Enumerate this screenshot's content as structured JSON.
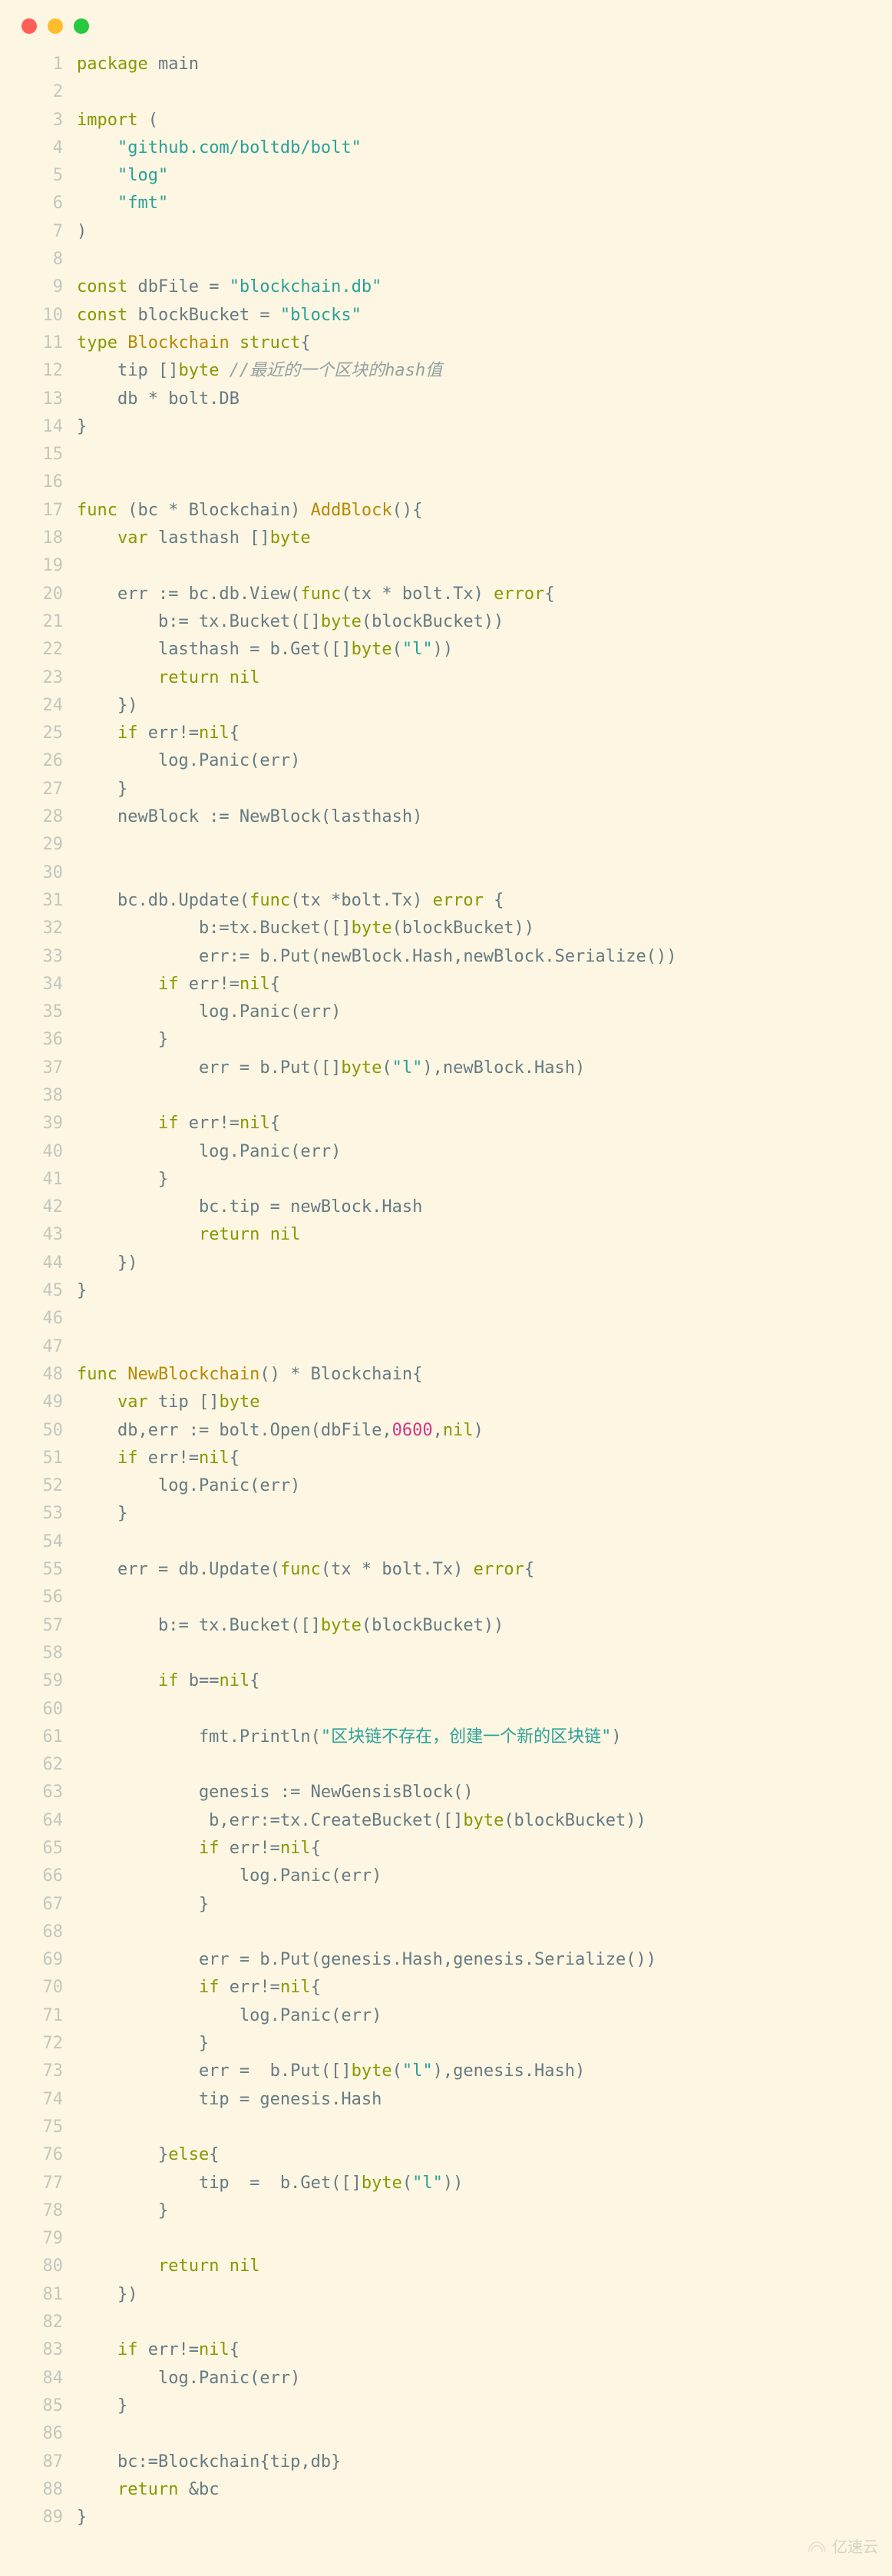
{
  "window": {
    "traffic_lights": [
      "red",
      "yellow",
      "green"
    ]
  },
  "watermark": "亿速云",
  "syntax": {
    "keywords": [
      "package",
      "import",
      "const",
      "type",
      "struct",
      "func",
      "var",
      "return",
      "if",
      "else",
      "nil",
      "error",
      "byte"
    ]
  },
  "code_lines": [
    {
      "n": 1,
      "tokens": [
        [
          "kw",
          "package"
        ],
        [
          "pln",
          " main"
        ]
      ]
    },
    {
      "n": 2,
      "tokens": [
        [
          "pln",
          ""
        ]
      ]
    },
    {
      "n": 3,
      "tokens": [
        [
          "kw",
          "import"
        ],
        [
          "pln",
          " ("
        ]
      ]
    },
    {
      "n": 4,
      "tokens": [
        [
          "pln",
          "    "
        ],
        [
          "str",
          "\"github.com/boltdb/bolt\""
        ]
      ]
    },
    {
      "n": 5,
      "tokens": [
        [
          "pln",
          "    "
        ],
        [
          "str",
          "\"log\""
        ]
      ]
    },
    {
      "n": 6,
      "tokens": [
        [
          "pln",
          "    "
        ],
        [
          "str",
          "\"fmt\""
        ]
      ]
    },
    {
      "n": 7,
      "tokens": [
        [
          "pln",
          ")"
        ]
      ]
    },
    {
      "n": 8,
      "tokens": [
        [
          "pln",
          ""
        ]
      ]
    },
    {
      "n": 9,
      "tokens": [
        [
          "kw",
          "const"
        ],
        [
          "pln",
          " dbFile = "
        ],
        [
          "str",
          "\"blockchain.db\""
        ]
      ]
    },
    {
      "n": 10,
      "tokens": [
        [
          "kw",
          "const"
        ],
        [
          "pln",
          " blockBucket = "
        ],
        [
          "str",
          "\"blocks\""
        ]
      ]
    },
    {
      "n": 11,
      "tokens": [
        [
          "kw",
          "type"
        ],
        [
          "pln",
          " "
        ],
        [
          "typ",
          "Blockchain"
        ],
        [
          "pln",
          " "
        ],
        [
          "kw",
          "struct"
        ],
        [
          "pln",
          "{"
        ]
      ]
    },
    {
      "n": 12,
      "tokens": [
        [
          "pln",
          "    tip []"
        ],
        [
          "kw",
          "byte"
        ],
        [
          "pln",
          " "
        ],
        [
          "cmt",
          "//最近的一个区块的hash值"
        ]
      ]
    },
    {
      "n": 13,
      "tokens": [
        [
          "pln",
          "    db * bolt.DB"
        ]
      ]
    },
    {
      "n": 14,
      "tokens": [
        [
          "pln",
          "}"
        ]
      ]
    },
    {
      "n": 15,
      "tokens": [
        [
          "pln",
          ""
        ]
      ]
    },
    {
      "n": 16,
      "tokens": [
        [
          "pln",
          ""
        ]
      ]
    },
    {
      "n": 17,
      "tokens": [
        [
          "kw",
          "func"
        ],
        [
          "pln",
          " (bc * Blockchain) "
        ],
        [
          "typ",
          "AddBlock"
        ],
        [
          "pln",
          "(){"
        ]
      ]
    },
    {
      "n": 18,
      "tokens": [
        [
          "pln",
          "    "
        ],
        [
          "kw",
          "var"
        ],
        [
          "pln",
          " lasthash []"
        ],
        [
          "kw",
          "byte"
        ]
      ]
    },
    {
      "n": 19,
      "tokens": [
        [
          "pln",
          ""
        ]
      ]
    },
    {
      "n": 20,
      "tokens": [
        [
          "pln",
          "    err := bc.db.View("
        ],
        [
          "kw",
          "func"
        ],
        [
          "pln",
          "(tx * bolt.Tx) "
        ],
        [
          "kw",
          "error"
        ],
        [
          "pln",
          "{"
        ]
      ]
    },
    {
      "n": 21,
      "tokens": [
        [
          "pln",
          "        b:= tx.Bucket([]"
        ],
        [
          "kw",
          "byte"
        ],
        [
          "pln",
          "(blockBucket))"
        ]
      ]
    },
    {
      "n": 22,
      "tokens": [
        [
          "pln",
          "        lasthash = b.Get([]"
        ],
        [
          "kw",
          "byte"
        ],
        [
          "pln",
          "("
        ],
        [
          "str",
          "\"l\""
        ],
        [
          "pln",
          "))"
        ]
      ]
    },
    {
      "n": 23,
      "tokens": [
        [
          "pln",
          "        "
        ],
        [
          "kw",
          "return"
        ],
        [
          "pln",
          " "
        ],
        [
          "kw",
          "nil"
        ]
      ]
    },
    {
      "n": 24,
      "tokens": [
        [
          "pln",
          "    })"
        ]
      ]
    },
    {
      "n": 25,
      "tokens": [
        [
          "pln",
          "    "
        ],
        [
          "kw",
          "if"
        ],
        [
          "pln",
          " err!="
        ],
        [
          "kw",
          "nil"
        ],
        [
          "pln",
          "{"
        ]
      ]
    },
    {
      "n": 26,
      "tokens": [
        [
          "pln",
          "        log.Panic(err)"
        ]
      ]
    },
    {
      "n": 27,
      "tokens": [
        [
          "pln",
          "    }"
        ]
      ]
    },
    {
      "n": 28,
      "tokens": [
        [
          "pln",
          "    newBlock := NewBlock(lasthash)"
        ]
      ]
    },
    {
      "n": 29,
      "tokens": [
        [
          "pln",
          ""
        ]
      ]
    },
    {
      "n": 30,
      "tokens": [
        [
          "pln",
          ""
        ]
      ]
    },
    {
      "n": 31,
      "tokens": [
        [
          "pln",
          "    bc.db.Update("
        ],
        [
          "kw",
          "func"
        ],
        [
          "pln",
          "(tx *bolt.Tx) "
        ],
        [
          "kw",
          "error"
        ],
        [
          "pln",
          " {"
        ]
      ]
    },
    {
      "n": 32,
      "tokens": [
        [
          "pln",
          "            b:=tx.Bucket([]"
        ],
        [
          "kw",
          "byte"
        ],
        [
          "pln",
          "(blockBucket))"
        ]
      ]
    },
    {
      "n": 33,
      "tokens": [
        [
          "pln",
          "            err:= b.Put(newBlock.Hash,newBlock.Serialize())"
        ]
      ]
    },
    {
      "n": 34,
      "tokens": [
        [
          "pln",
          "        "
        ],
        [
          "kw",
          "if"
        ],
        [
          "pln",
          " err!="
        ],
        [
          "kw",
          "nil"
        ],
        [
          "pln",
          "{"
        ]
      ]
    },
    {
      "n": 35,
      "tokens": [
        [
          "pln",
          "            log.Panic(err)"
        ]
      ]
    },
    {
      "n": 36,
      "tokens": [
        [
          "pln",
          "        }"
        ]
      ]
    },
    {
      "n": 37,
      "tokens": [
        [
          "pln",
          "            err = b.Put([]"
        ],
        [
          "kw",
          "byte"
        ],
        [
          "pln",
          "("
        ],
        [
          "str",
          "\"l\""
        ],
        [
          "pln",
          "),newBlock.Hash)"
        ]
      ]
    },
    {
      "n": 38,
      "tokens": [
        [
          "pln",
          ""
        ]
      ]
    },
    {
      "n": 39,
      "tokens": [
        [
          "pln",
          "        "
        ],
        [
          "kw",
          "if"
        ],
        [
          "pln",
          " err!="
        ],
        [
          "kw",
          "nil"
        ],
        [
          "pln",
          "{"
        ]
      ]
    },
    {
      "n": 40,
      "tokens": [
        [
          "pln",
          "            log.Panic(err)"
        ]
      ]
    },
    {
      "n": 41,
      "tokens": [
        [
          "pln",
          "        }"
        ]
      ]
    },
    {
      "n": 42,
      "tokens": [
        [
          "pln",
          "            bc.tip = newBlock.Hash"
        ]
      ]
    },
    {
      "n": 43,
      "tokens": [
        [
          "pln",
          "            "
        ],
        [
          "kw",
          "return"
        ],
        [
          "pln",
          " "
        ],
        [
          "kw",
          "nil"
        ]
      ]
    },
    {
      "n": 44,
      "tokens": [
        [
          "pln",
          "    })"
        ]
      ]
    },
    {
      "n": 45,
      "tokens": [
        [
          "pln",
          "}"
        ]
      ]
    },
    {
      "n": 46,
      "tokens": [
        [
          "pln",
          ""
        ]
      ]
    },
    {
      "n": 47,
      "tokens": [
        [
          "pln",
          ""
        ]
      ]
    },
    {
      "n": 48,
      "tokens": [
        [
          "kw",
          "func"
        ],
        [
          "pln",
          " "
        ],
        [
          "typ",
          "NewBlockchain"
        ],
        [
          "pln",
          "() * Blockchain{"
        ]
      ]
    },
    {
      "n": 49,
      "tokens": [
        [
          "pln",
          "    "
        ],
        [
          "kw",
          "var"
        ],
        [
          "pln",
          " tip []"
        ],
        [
          "kw",
          "byte"
        ]
      ]
    },
    {
      "n": 50,
      "tokens": [
        [
          "pln",
          "    db,err := bolt.Open(dbFile,"
        ],
        [
          "num",
          "0600"
        ],
        [
          "pln",
          ","
        ],
        [
          "kw",
          "nil"
        ],
        [
          "pln",
          ")"
        ]
      ]
    },
    {
      "n": 51,
      "tokens": [
        [
          "pln",
          "    "
        ],
        [
          "kw",
          "if"
        ],
        [
          "pln",
          " err!="
        ],
        [
          "kw",
          "nil"
        ],
        [
          "pln",
          "{"
        ]
      ]
    },
    {
      "n": 52,
      "tokens": [
        [
          "pln",
          "        log.Panic(err)"
        ]
      ]
    },
    {
      "n": 53,
      "tokens": [
        [
          "pln",
          "    }"
        ]
      ]
    },
    {
      "n": 54,
      "tokens": [
        [
          "pln",
          ""
        ]
      ]
    },
    {
      "n": 55,
      "tokens": [
        [
          "pln",
          "    err = db.Update("
        ],
        [
          "kw",
          "func"
        ],
        [
          "pln",
          "(tx * bolt.Tx) "
        ],
        [
          "kw",
          "error"
        ],
        [
          "pln",
          "{"
        ]
      ]
    },
    {
      "n": 56,
      "tokens": [
        [
          "pln",
          ""
        ]
      ]
    },
    {
      "n": 57,
      "tokens": [
        [
          "pln",
          "        b:= tx.Bucket([]"
        ],
        [
          "kw",
          "byte"
        ],
        [
          "pln",
          "(blockBucket))"
        ]
      ]
    },
    {
      "n": 58,
      "tokens": [
        [
          "pln",
          ""
        ]
      ]
    },
    {
      "n": 59,
      "tokens": [
        [
          "pln",
          "        "
        ],
        [
          "kw",
          "if"
        ],
        [
          "pln",
          " b=="
        ],
        [
          "kw",
          "nil"
        ],
        [
          "pln",
          "{"
        ]
      ]
    },
    {
      "n": 60,
      "tokens": [
        [
          "pln",
          ""
        ]
      ]
    },
    {
      "n": 61,
      "tokens": [
        [
          "pln",
          "            fmt.Println("
        ],
        [
          "str",
          "\"区块链不存在，创建一个新的区块链\""
        ],
        [
          "pln",
          ")"
        ]
      ]
    },
    {
      "n": 62,
      "tokens": [
        [
          "pln",
          ""
        ]
      ]
    },
    {
      "n": 63,
      "tokens": [
        [
          "pln",
          "            genesis := NewGensisBlock()"
        ]
      ]
    },
    {
      "n": 64,
      "tokens": [
        [
          "pln",
          "             b,err:=tx.CreateBucket([]"
        ],
        [
          "kw",
          "byte"
        ],
        [
          "pln",
          "(blockBucket))"
        ]
      ]
    },
    {
      "n": 65,
      "tokens": [
        [
          "pln",
          "            "
        ],
        [
          "kw",
          "if"
        ],
        [
          "pln",
          " err!="
        ],
        [
          "kw",
          "nil"
        ],
        [
          "pln",
          "{"
        ]
      ]
    },
    {
      "n": 66,
      "tokens": [
        [
          "pln",
          "                log.Panic(err)"
        ]
      ]
    },
    {
      "n": 67,
      "tokens": [
        [
          "pln",
          "            }"
        ]
      ]
    },
    {
      "n": 68,
      "tokens": [
        [
          "pln",
          ""
        ]
      ]
    },
    {
      "n": 69,
      "tokens": [
        [
          "pln",
          "            err = b.Put(genesis.Hash,genesis.Serialize())"
        ]
      ]
    },
    {
      "n": 70,
      "tokens": [
        [
          "pln",
          "            "
        ],
        [
          "kw",
          "if"
        ],
        [
          "pln",
          " err!="
        ],
        [
          "kw",
          "nil"
        ],
        [
          "pln",
          "{"
        ]
      ]
    },
    {
      "n": 71,
      "tokens": [
        [
          "pln",
          "                log.Panic(err)"
        ]
      ]
    },
    {
      "n": 72,
      "tokens": [
        [
          "pln",
          "            }"
        ]
      ]
    },
    {
      "n": 73,
      "tokens": [
        [
          "pln",
          "            err =  b.Put([]"
        ],
        [
          "kw",
          "byte"
        ],
        [
          "pln",
          "("
        ],
        [
          "str",
          "\"l\""
        ],
        [
          "pln",
          "),genesis.Hash)"
        ]
      ]
    },
    {
      "n": 74,
      "tokens": [
        [
          "pln",
          "            tip = genesis.Hash"
        ]
      ]
    },
    {
      "n": 75,
      "tokens": [
        [
          "pln",
          ""
        ]
      ]
    },
    {
      "n": 76,
      "tokens": [
        [
          "pln",
          "        }"
        ],
        [
          "kw",
          "else"
        ],
        [
          "pln",
          "{"
        ]
      ]
    },
    {
      "n": 77,
      "tokens": [
        [
          "pln",
          "            tip  =  b.Get([]"
        ],
        [
          "kw",
          "byte"
        ],
        [
          "pln",
          "("
        ],
        [
          "str",
          "\"l\""
        ],
        [
          "pln",
          "))"
        ]
      ]
    },
    {
      "n": 78,
      "tokens": [
        [
          "pln",
          "        }"
        ]
      ]
    },
    {
      "n": 79,
      "tokens": [
        [
          "pln",
          ""
        ]
      ]
    },
    {
      "n": 80,
      "tokens": [
        [
          "pln",
          "        "
        ],
        [
          "kw",
          "return"
        ],
        [
          "pln",
          " "
        ],
        [
          "kw",
          "nil"
        ]
      ]
    },
    {
      "n": 81,
      "tokens": [
        [
          "pln",
          "    })"
        ]
      ]
    },
    {
      "n": 82,
      "tokens": [
        [
          "pln",
          ""
        ]
      ]
    },
    {
      "n": 83,
      "tokens": [
        [
          "pln",
          "    "
        ],
        [
          "kw",
          "if"
        ],
        [
          "pln",
          " err!="
        ],
        [
          "kw",
          "nil"
        ],
        [
          "pln",
          "{"
        ]
      ]
    },
    {
      "n": 84,
      "tokens": [
        [
          "pln",
          "        log.Panic(err)"
        ]
      ]
    },
    {
      "n": 85,
      "tokens": [
        [
          "pln",
          "    }"
        ]
      ]
    },
    {
      "n": 86,
      "tokens": [
        [
          "pln",
          ""
        ]
      ]
    },
    {
      "n": 87,
      "tokens": [
        [
          "pln",
          "    bc:=Blockchain{tip,db}"
        ]
      ]
    },
    {
      "n": 88,
      "tokens": [
        [
          "pln",
          "    "
        ],
        [
          "kw",
          "return"
        ],
        [
          "pln",
          " &bc"
        ]
      ]
    },
    {
      "n": 89,
      "tokens": [
        [
          "pln",
          "}"
        ]
      ]
    }
  ]
}
